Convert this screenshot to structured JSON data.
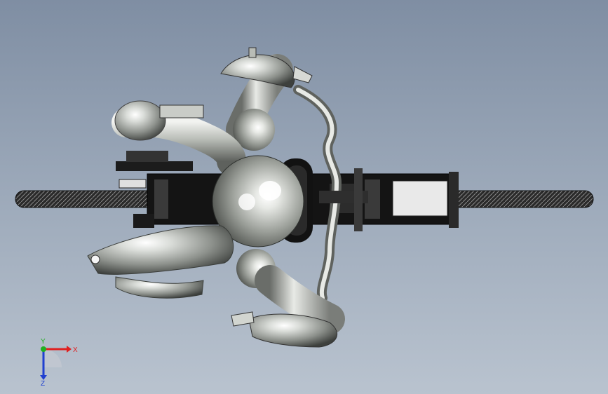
{
  "viewport": {
    "description_free": true,
    "background_top": "#7f8ea3",
    "background_bottom": "#b9c3cf"
  },
  "triad": {
    "x_label": "X",
    "y_label": "Y",
    "z_label": "Z",
    "x_color": "#e02020",
    "y_color": "#20b020",
    "z_color": "#2040d0"
  }
}
